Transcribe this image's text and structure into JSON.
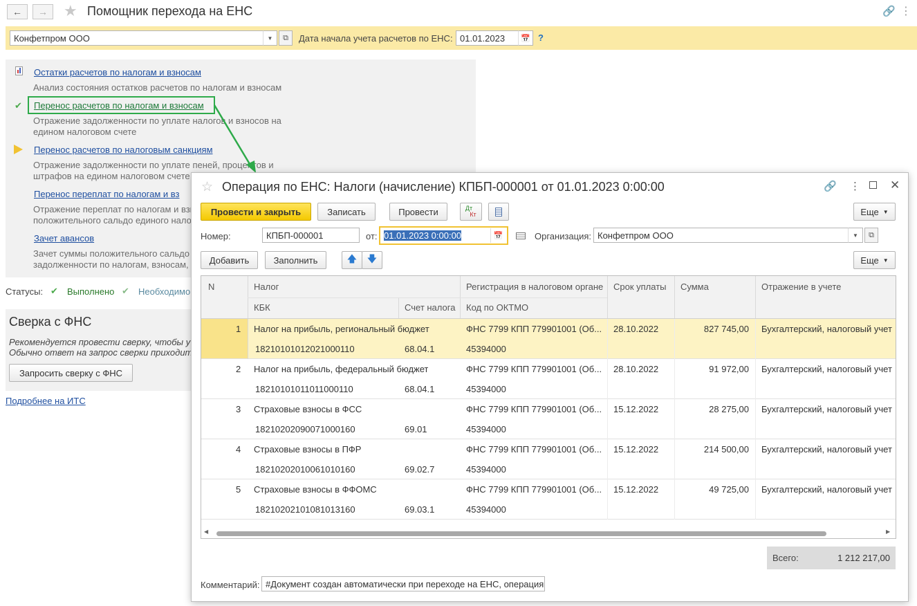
{
  "window": {
    "title": "Помощник перехода на ЕНС"
  },
  "filter": {
    "organization": "Конфетпром ООО",
    "start_date_label": "Дата начала учета расчетов по ЕНС:",
    "start_date": "01.01.2023",
    "help": "?"
  },
  "steps": [
    {
      "link": "Остатки расчетов по налогам и взносам",
      "desc": "Анализ состояния остатков расчетов по налогам и взносам"
    },
    {
      "link": "Перенос расчетов по налогам и взносам",
      "desc": "Отражение задолженности по уплате налогов и взносов на едином налоговом счете"
    },
    {
      "link": "Перенос расчетов по налоговым санкциям",
      "desc": "Отражение задолженности по уплате пеней, процентов и штрафов на едином налоговом счете"
    },
    {
      "link": "Перенос переплат по налогам и вз",
      "desc": "Отражение переплат по налогам и взн положительного сальдо единого нало"
    },
    {
      "link": "Зачет авансов",
      "desc": "Зачет суммы положительного сальдо задолженности по налогам, взносам,"
    }
  ],
  "statuses": {
    "label": "Статусы:",
    "done": "Выполнено",
    "required": "Необходимо"
  },
  "reconciliation": {
    "title": "Сверка с ФНС",
    "text1": "Рекомендуется провести сверку, чтобы у",
    "text2": "Обычно ответ на запрос сверки приходит",
    "button": "Запросить сверку с ФНС",
    "more_link": "Подробнее на ИТС"
  },
  "doc": {
    "title": "Операция по ЕНС: Налоги (начисление) КПБП-000001 от 01.01.2023 0:00:00",
    "toolbar": {
      "post_close": "Провести и закрыть",
      "save": "Записать",
      "post": "Провести",
      "dtkt_top": "Дт",
      "dtkt_bottom": "Кт",
      "more": "Еще"
    },
    "number_label": "Номер:",
    "number": "КПБП-000001",
    "from_label": "от:",
    "date": "01.01.2023  0:00:00",
    "org_label": "Организация:",
    "org": "Конфетпром ООО",
    "table_toolbar": {
      "add": "Добавить",
      "fill": "Заполнить",
      "more": "Еще"
    },
    "columns": {
      "n": "N",
      "tax": "Налог",
      "kbk": "КБК",
      "account": "Счет налога",
      "registration": "Регистрация в налоговом органе",
      "oktmo": "Код по ОКТМО",
      "due": "Срок уплаты",
      "amount": "Сумма",
      "reflection": "Отражение в учете"
    },
    "rows": [
      {
        "n": "1",
        "tax": "Налог на прибыль, региональный бюджет",
        "kbk": "18210101012021000110",
        "account": "68.04.1",
        "registration": "ФНС 7799 КПП 779901001 (Об...",
        "oktmo": "45394000",
        "due": "28.10.2022",
        "amount": "827 745,00",
        "reflection": "Бухгалтерский, налоговый учет"
      },
      {
        "n": "2",
        "tax": "Налог на прибыль, федеральный бюджет",
        "kbk": "18210101011011000110",
        "account": "68.04.1",
        "registration": "ФНС 7799 КПП 779901001 (Об...",
        "oktmo": "45394000",
        "due": "28.10.2022",
        "amount": "91 972,00",
        "reflection": "Бухгалтерский, налоговый учет"
      },
      {
        "n": "3",
        "tax": "Страховые взносы в ФСС",
        "kbk": "18210202090071000160",
        "account": "69.01",
        "registration": "ФНС 7799 КПП 779901001 (Об...",
        "oktmo": "45394000",
        "due": "15.12.2022",
        "amount": "28 275,00",
        "reflection": "Бухгалтерский, налоговый учет"
      },
      {
        "n": "4",
        "tax": "Страховые взносы в ПФР",
        "kbk": "18210202010061010160",
        "account": "69.02.7",
        "registration": "ФНС 7799 КПП 779901001 (Об...",
        "oktmo": "45394000",
        "due": "15.12.2022",
        "amount": "214 500,00",
        "reflection": "Бухгалтерский, налоговый учет"
      },
      {
        "n": "5",
        "tax": "Страховые взносы в ФФОМС",
        "kbk": "18210202101081013160",
        "account": "69.03.1",
        "registration": "ФНС 7799 КПП 779901001 (Об...",
        "oktmo": "45394000",
        "due": "15.12.2022",
        "amount": "49 725,00",
        "reflection": "Бухгалтерский, налоговый учет"
      }
    ],
    "total_label": "Всего:",
    "total": "1 212 217,00",
    "comment_label": "Комментарий:",
    "comment": "#Документ создан автоматически при переходе на ЕНС, операция"
  },
  "colors": {
    "yellow_bar": "#fbeaa6",
    "selected_row": "#fdf3c4",
    "primary_button": "#f4c900",
    "link": "#1f4fa0",
    "highlight_border": "#2eaa4a"
  }
}
